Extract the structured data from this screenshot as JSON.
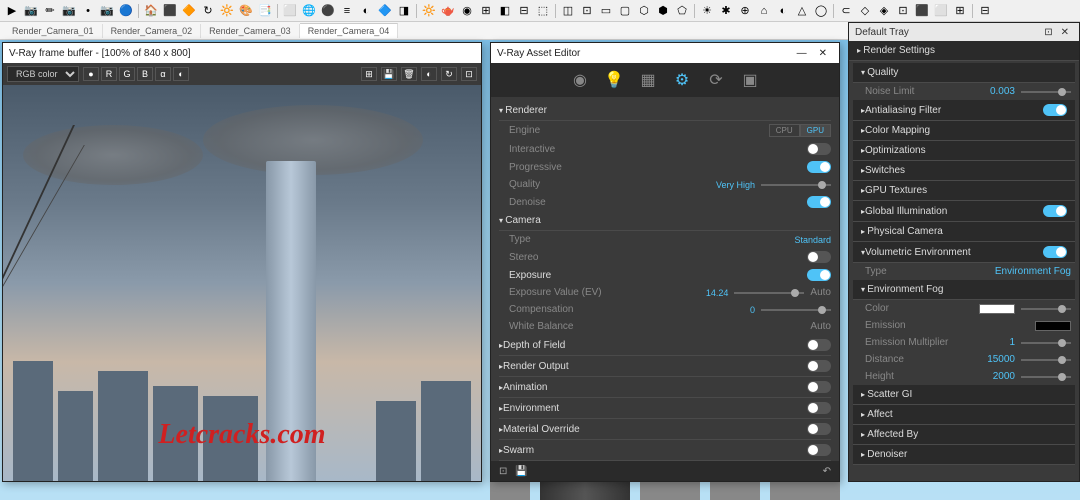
{
  "toolbar_icons": [
    "▶",
    "📷",
    "✏",
    "📷",
    "•",
    "📷",
    "🔵",
    "🏠",
    "⬛",
    "🔶",
    "↻",
    "🔆",
    "🎨",
    "📑",
    "⬜",
    "🌐",
    "⚫",
    "≡",
    "◐",
    "🔷",
    "◨",
    "🔆",
    "🫖",
    "◉",
    "⊞",
    "◧",
    "⊟",
    "⬚",
    "◫",
    "⊡",
    "▭",
    "▢",
    "⬡",
    "⬢",
    "⬠",
    "☀",
    "✱",
    "⊕",
    "⌂",
    "◐",
    "△",
    "◯",
    "⊂",
    "◇",
    "◈",
    "⊡",
    "⬛",
    "⬜",
    "⊞",
    "⊟"
  ],
  "scene_tabs": [
    "Render_Camera_01",
    "Render_Camera_02",
    "Render_Camera_03",
    "Render_Camera_04"
  ],
  "active_scene": 3,
  "frame_buffer": {
    "title": "V-Ray frame buffer - [100% of 840 x 800]",
    "rgb_select": "RGB color",
    "channels": [
      "●",
      "R",
      "G",
      "B",
      "α",
      "◐"
    ]
  },
  "watermark": "Letcracks.com",
  "asset_editor": {
    "title": "V-Ray Asset Editor",
    "tabs": [
      "◉",
      "💡",
      "▦",
      "⚙",
      "⟳",
      "▣"
    ],
    "active_tab": 3,
    "renderer": {
      "label": "Renderer",
      "engine_label": "Engine",
      "engine_cpu": "CPU",
      "engine_gpu": "GPU",
      "interactive_label": "Interactive",
      "progressive_label": "Progressive",
      "quality_label": "Quality",
      "quality_value": "Very High",
      "denoise_label": "Denoise"
    },
    "camera": {
      "label": "Camera",
      "type_label": "Type",
      "type_value": "Standard",
      "stereo_label": "Stereo",
      "exposure_label": "Exposure",
      "ev_label": "Exposure Value (EV)",
      "ev_value": "14.24",
      "ev_auto": "Auto",
      "comp_label": "Compensation",
      "comp_value": "0",
      "wb_label": "White Balance",
      "wb_auto": "Auto"
    },
    "sections": [
      "Depth of Field",
      "Render Output",
      "Animation",
      "Environment",
      "Material Override",
      "Swarm"
    ]
  },
  "default_tray": {
    "title": "Default Tray",
    "render_settings_label": "Render Settings",
    "quality": {
      "label": "Quality",
      "noise_label": "Noise Limit",
      "noise_value": "0.003"
    },
    "sections1": [
      "Antialiasing Filter",
      "Color Mapping",
      "Optimizations",
      "Switches",
      "GPU Textures"
    ],
    "gi": {
      "label": "Global Illumination"
    },
    "phys_cam": {
      "label": "Physical Camera"
    },
    "vol_env": {
      "label": "Volumetric Environment",
      "type_label": "Type",
      "type_value": "Environment Fog"
    },
    "env_fog": {
      "label": "Environment Fog",
      "color_label": "Color",
      "emission_label": "Emission",
      "em_mult_label": "Emission Multiplier",
      "em_mult_value": "1",
      "distance_label": "Distance",
      "distance_value": "15000",
      "height_label": "Height",
      "height_value": "2000"
    },
    "sections2": [
      "Scatter GI",
      "Affect",
      "Affected By",
      "Denoiser"
    ]
  }
}
